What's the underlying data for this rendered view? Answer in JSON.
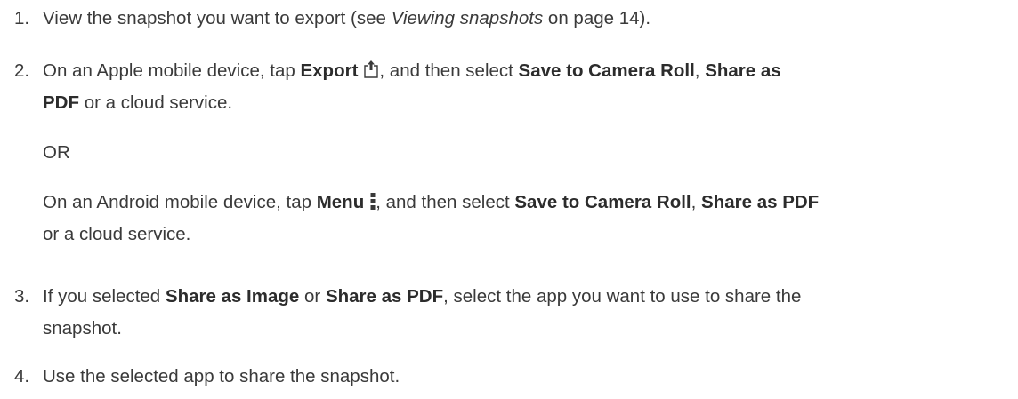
{
  "steps": [
    {
      "number": "1.",
      "line1_pre": "View the snapshot you want to export (see ",
      "line1_link": "Viewing snapshots",
      "line1_post": " on page 14)."
    },
    {
      "number": "2.",
      "line1_pre": "On an Apple mobile device, tap ",
      "export_label": "Export",
      "line1_mid": ", and then select ",
      "save_camera_roll": "Save to Camera Roll",
      "comma1": ", ",
      "share_as": "Share as",
      "line2_pdf": "PDF",
      "line2_post": " or a cloud service.",
      "or_text": "OR",
      "android_pre": "On an Android mobile device, tap ",
      "menu_label": "Menu",
      "android_mid": ", and then select ",
      "android_save": "Save to Camera Roll",
      "android_comma": ", ",
      "android_share_pdf": "Share as PDF",
      "android_post": "or a cloud service."
    },
    {
      "number": "3.",
      "line1_pre": "If you selected ",
      "share_image": "Share as Image",
      "or_word": " or ",
      "share_pdf": "Share as PDF",
      "line1_post": ", select the app you want to use to share the",
      "line2": "snapshot."
    },
    {
      "number": "4.",
      "line1": "Use the selected app to share the snapshot."
    }
  ],
  "icons": {
    "export": "export-share-icon",
    "menu": "menu-vertical-dots-icon"
  }
}
